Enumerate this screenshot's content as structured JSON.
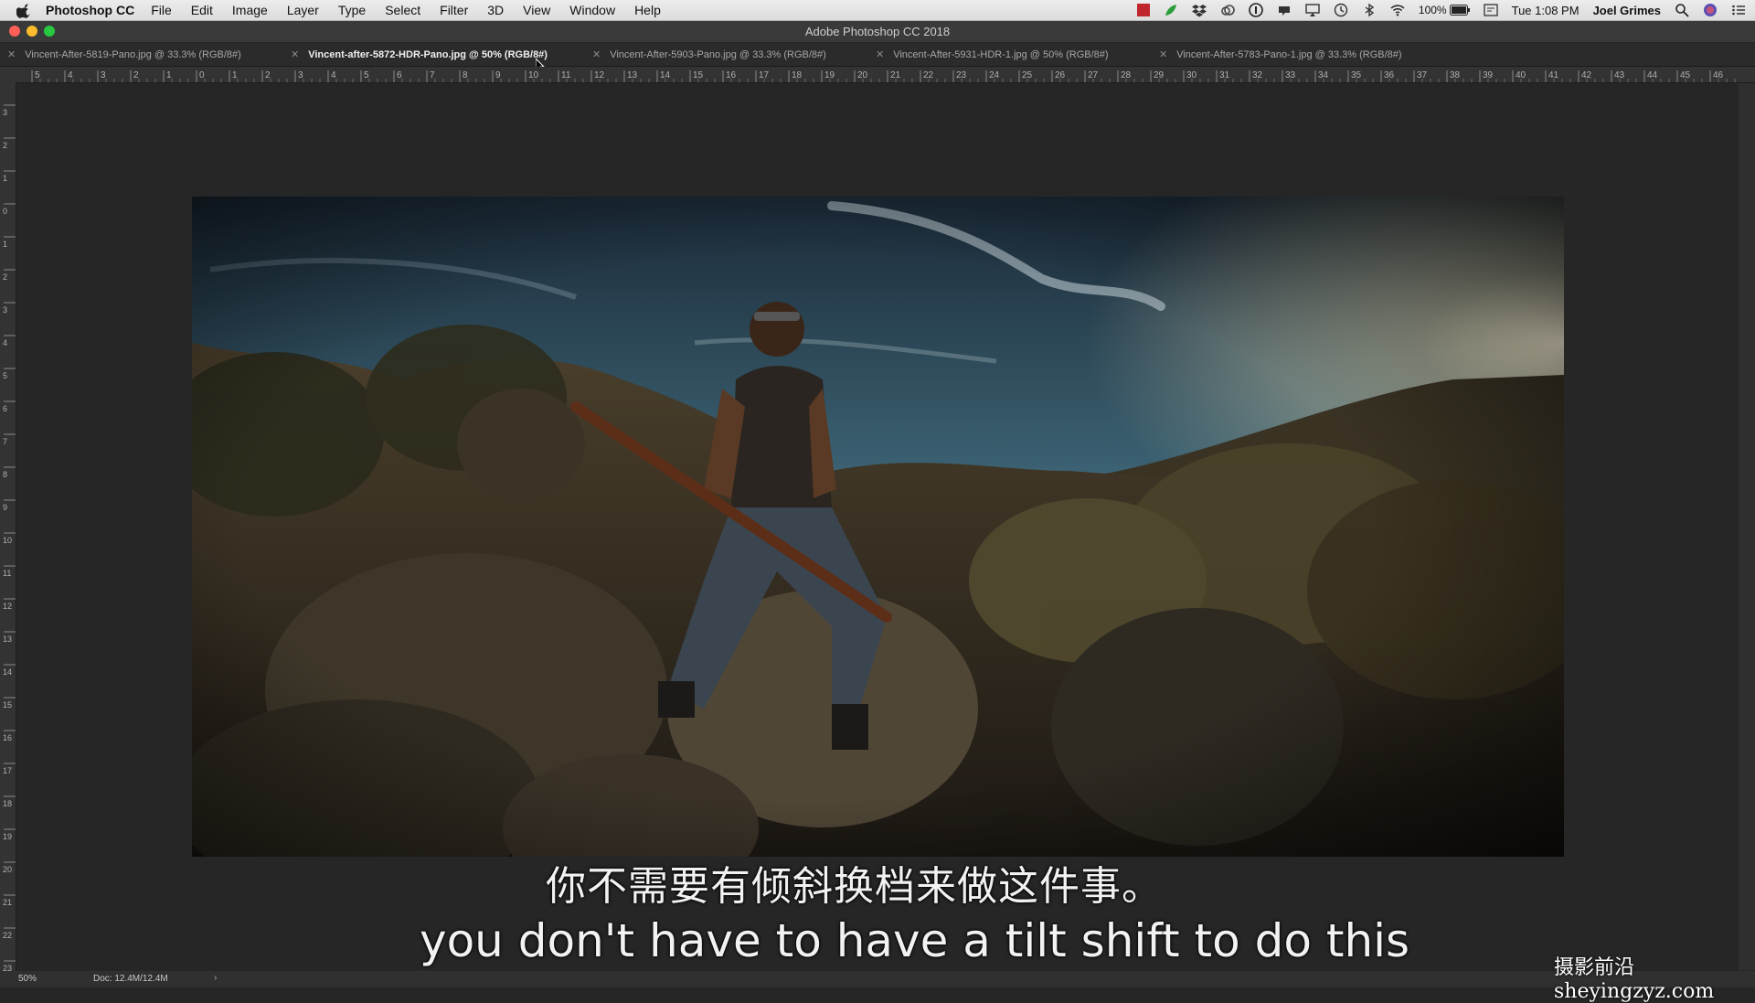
{
  "menubar": {
    "app_name": "Photoshop CC",
    "items": [
      "File",
      "Edit",
      "Image",
      "Layer",
      "Type",
      "Select",
      "Filter",
      "3D",
      "View",
      "Window",
      "Help"
    ],
    "battery": "100%",
    "clock": "Tue 1:08 PM",
    "user": "Joel Grimes"
  },
  "window": {
    "title": "Adobe Photoshop CC 2018"
  },
  "tabs": [
    {
      "label": "Vincent-After-5819-Pano.jpg @ 33.3% (RGB/8#)",
      "active": false
    },
    {
      "label": "Vincent-after-5872-HDR-Pano.jpg @ 50% (RGB/8#)",
      "active": true
    },
    {
      "label": "Vincent-After-5903-Pano.jpg @ 33.3% (RGB/8#)",
      "active": false
    },
    {
      "label": "Vincent-After-5931-HDR-1.jpg @ 50% (RGB/8#)",
      "active": false
    },
    {
      "label": "Vincent-After-5783-Pano-1.jpg @ 33.3% (RGB/8#)",
      "active": false
    }
  ],
  "status": {
    "zoom": "50%",
    "doc": "Doc: 12.4M/12.4M"
  },
  "subtitles": {
    "zh": "你不需要有倾斜换档来做这件事。",
    "en": "you don't have to have a tilt shift to do this"
  },
  "watermark": "摄影前沿 sheyingzyz.com",
  "colors": {
    "canvas": "#262626",
    "ui_dark": "#2b2b2b",
    "active_tab_text": "#f0f0f0"
  }
}
